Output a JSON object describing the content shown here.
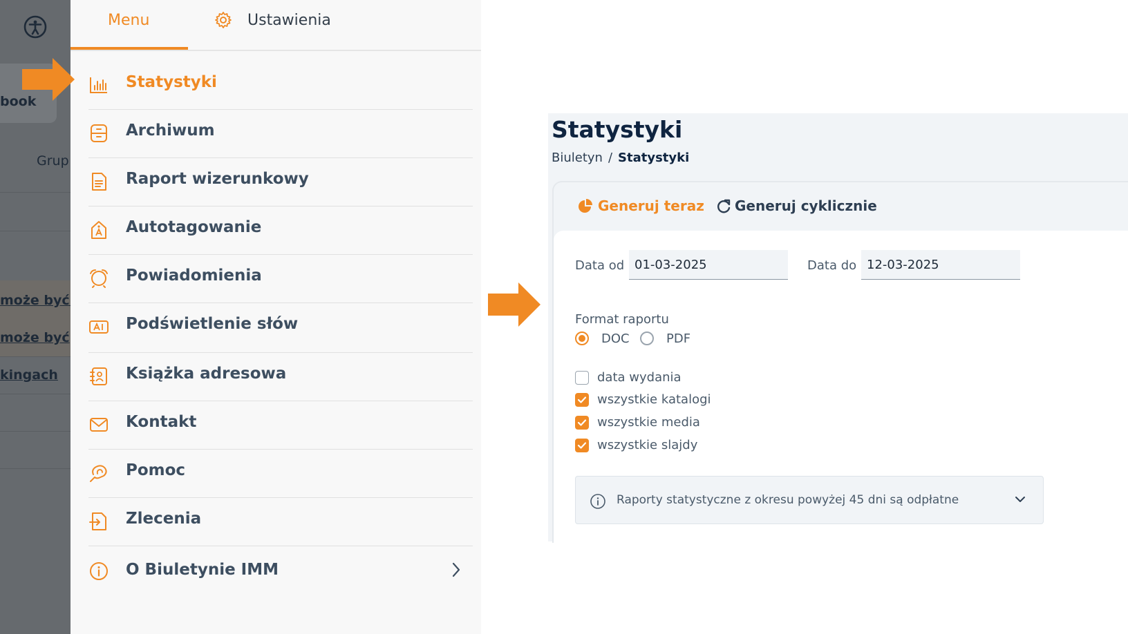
{
  "background_app": {
    "book_label": "book",
    "group_label": "Grup",
    "links": [
      "może być s",
      "może być",
      "kingach"
    ]
  },
  "menu": {
    "tabs": {
      "menu_label": "Menu",
      "settings_label": "Ustawienia"
    },
    "items": [
      {
        "label": "Statystyki",
        "icon": "bar-chart-icon",
        "active": true
      },
      {
        "label": "Archiwum",
        "icon": "archive-icon"
      },
      {
        "label": "Raport wizerunkowy",
        "icon": "document-report-icon"
      },
      {
        "label": "Autotagowanie",
        "icon": "tag-icon"
      },
      {
        "label": "Powiadomienia",
        "icon": "alarm-icon"
      },
      {
        "label": "Podświetlenie słów",
        "icon": "highlight-text-icon"
      },
      {
        "label": "Książka adresowa",
        "icon": "address-book-icon"
      },
      {
        "label": "Kontakt",
        "icon": "mail-icon"
      },
      {
        "label": "Pomoc",
        "icon": "help-hand-icon"
      },
      {
        "label": "Zlecenia",
        "icon": "orders-icon"
      },
      {
        "label": "O Biuletynie IMM",
        "icon": "info-icon"
      }
    ]
  },
  "stats": {
    "title": "Statystyki",
    "breadcrumb": {
      "root": "Biuletyn",
      "separator": "/",
      "current": "Statystyki"
    },
    "tabs": {
      "now_label": "Generuj teraz",
      "cyclic_label": "Generuj cyklicznie"
    },
    "date_from": {
      "label": "Data od",
      "value": "01-03-2025"
    },
    "date_to": {
      "label": "Data do",
      "value": "12-03-2025"
    },
    "format": {
      "label": "Format raportu",
      "options": [
        {
          "label": "DOC",
          "selected": true
        },
        {
          "label": "PDF",
          "selected": false
        }
      ]
    },
    "checkboxes": [
      {
        "label": "data wydania",
        "checked": false
      },
      {
        "label": "wszystkie katalogi",
        "checked": true
      },
      {
        "label": "wszystkie media",
        "checked": true
      },
      {
        "label": "wszystkie slajdy",
        "checked": true
      }
    ],
    "info_text": "Raporty statystyczne z okresu powyżej 45 dni są odpłatne"
  },
  "colors": {
    "accent": "#f08a24",
    "title": "#0f2440",
    "menu_text": "#3d4e60",
    "overlay": "#666a6e"
  }
}
